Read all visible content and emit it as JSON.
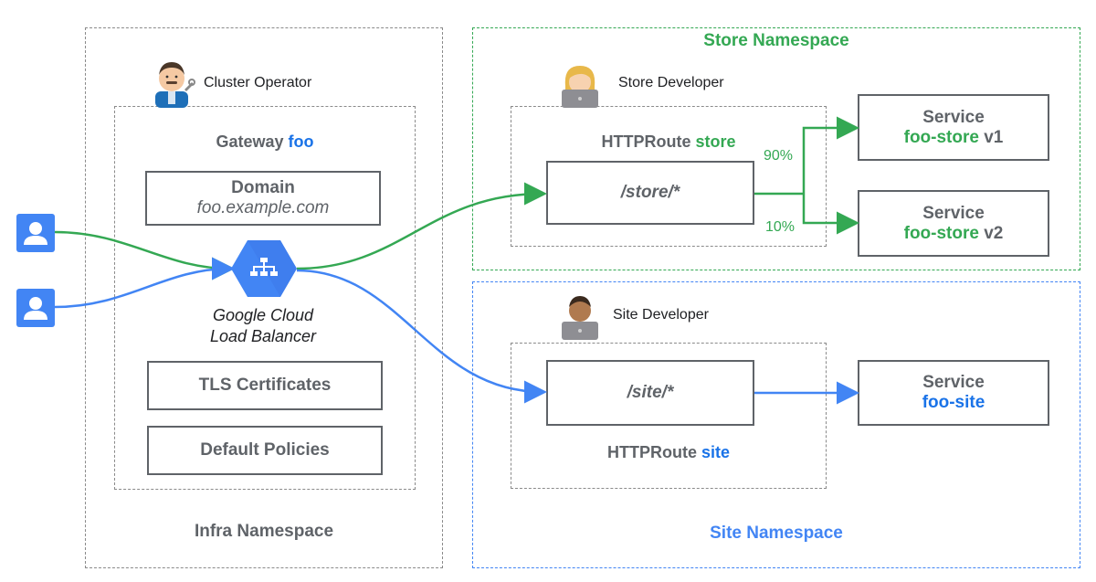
{
  "infra": {
    "namespace_label": "Infra Namespace",
    "operator_label": "Cluster Operator",
    "gateway_prefix": "Gateway",
    "gateway_name": "foo",
    "domain_title": "Domain",
    "domain_value": "foo.example.com",
    "lb_line1": "Google Cloud",
    "lb_line2": "Load Balancer",
    "tls_label": "TLS Certificates",
    "policies_label": "Default Policies"
  },
  "store": {
    "namespace_label": "Store Namespace",
    "developer_label": "Store Developer",
    "route_prefix": "HTTPRoute",
    "route_name": "store",
    "path": "/store/*",
    "split_v1": "90%",
    "split_v2": "10%",
    "service_v1_title": "Service",
    "service_v1_name": "foo-store",
    "service_v1_version": "v1",
    "service_v2_title": "Service",
    "service_v2_name": "foo-store",
    "service_v2_version": "v2"
  },
  "site": {
    "namespace_label": "Site Namespace",
    "developer_label": "Site Developer",
    "route_prefix": "HTTPRoute",
    "route_name": "site",
    "path": "/site/*",
    "service_title": "Service",
    "service_name": "foo-site"
  },
  "colors": {
    "green": "#34a853",
    "blue": "#4285f4",
    "gray": "#5f6368",
    "user_icon_bg": "#4285f4"
  },
  "icons": {
    "user": "user-icon",
    "load_balancer": "load-balancer-icon",
    "operator": "operator-emoji",
    "developer": "developer-emoji"
  }
}
